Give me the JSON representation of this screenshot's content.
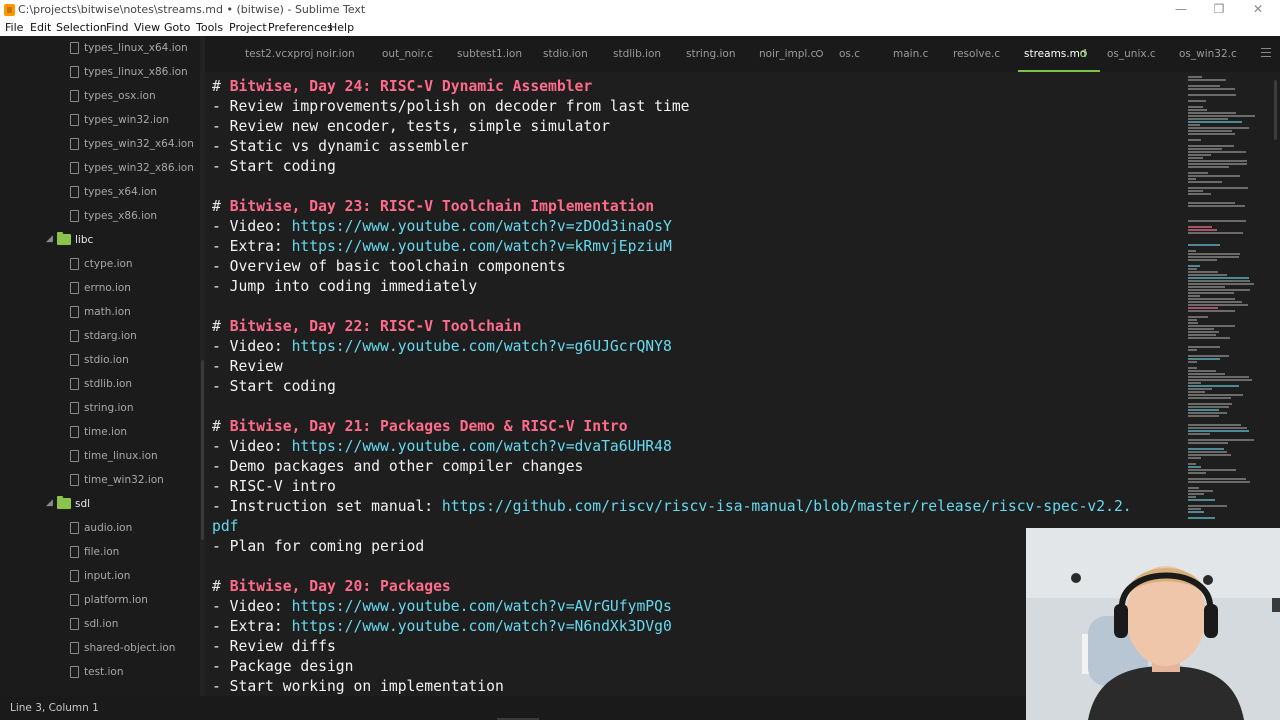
{
  "window": {
    "title": "C:\\projects\\bitwise\\notes\\streams.md • (bitwise) - Sublime Text",
    "minimize_glyph": "—",
    "maximize_glyph": "❐",
    "close_glyph": "✕"
  },
  "menu": [
    "File",
    "Edit",
    "Selection",
    "Find",
    "View",
    "Goto",
    "Tools",
    "Project",
    "Preferences",
    "Help"
  ],
  "sidebar": {
    "items": [
      {
        "type": "file",
        "label": "types_linux_x64.ion"
      },
      {
        "type": "file",
        "label": "types_linux_x86.ion"
      },
      {
        "type": "file",
        "label": "types_osx.ion"
      },
      {
        "type": "file",
        "label": "types_win32.ion"
      },
      {
        "type": "file",
        "label": "types_win32_x64.ion"
      },
      {
        "type": "file",
        "label": "types_win32_x86.ion"
      },
      {
        "type": "file",
        "label": "types_x64.ion"
      },
      {
        "type": "file",
        "label": "types_x86.ion"
      },
      {
        "type": "folder",
        "label": "libc",
        "chevron": "◢"
      },
      {
        "type": "file",
        "label": "ctype.ion"
      },
      {
        "type": "file",
        "label": "errno.ion"
      },
      {
        "type": "file",
        "label": "math.ion"
      },
      {
        "type": "file",
        "label": "stdarg.ion"
      },
      {
        "type": "file",
        "label": "stdio.ion"
      },
      {
        "type": "file",
        "label": "stdlib.ion"
      },
      {
        "type": "file",
        "label": "string.ion"
      },
      {
        "type": "file",
        "label": "time.ion"
      },
      {
        "type": "file",
        "label": "time_linux.ion"
      },
      {
        "type": "file",
        "label": "time_win32.ion"
      },
      {
        "type": "folder",
        "label": "sdl",
        "chevron": "◢"
      },
      {
        "type": "file",
        "label": "audio.ion"
      },
      {
        "type": "file",
        "label": "file.ion"
      },
      {
        "type": "file",
        "label": "input.ion"
      },
      {
        "type": "file",
        "label": "platform.ion"
      },
      {
        "type": "file",
        "label": "sdl.ion"
      },
      {
        "type": "file",
        "label": "shared-object.ion"
      },
      {
        "type": "file",
        "label": "test.ion"
      }
    ]
  },
  "tabs": [
    {
      "label": "test2.vcxproj"
    },
    {
      "label": "noir.ion"
    },
    {
      "label": "out_noir.c"
    },
    {
      "label": "subtest1.ion"
    },
    {
      "label": "stdio.ion"
    },
    {
      "label": "stdlib.ion"
    },
    {
      "label": "string.ion"
    },
    {
      "label": "noir_impl.c",
      "dirty": true
    },
    {
      "label": "os.c"
    },
    {
      "label": "main.c"
    },
    {
      "label": "resolve.c"
    },
    {
      "label": "streams.md",
      "active": true,
      "dirty": true
    },
    {
      "label": "os_unix.c"
    },
    {
      "label": "os_win32.c"
    }
  ],
  "editor": {
    "lines": [
      {
        "parts": [
          {
            "k": "hash",
            "t": "# "
          },
          {
            "k": "head",
            "t": "Bitwise, Day 24: RISC-V Dynamic Assembler"
          }
        ]
      },
      {
        "parts": [
          {
            "k": "text",
            "t": "- Review improvements/polish on decoder from last time"
          }
        ]
      },
      {
        "parts": [
          {
            "k": "text",
            "t": "- Review new encoder, tests, simple simulator"
          }
        ]
      },
      {
        "parts": [
          {
            "k": "text",
            "t": "- Static vs dynamic assembler"
          }
        ]
      },
      {
        "parts": [
          {
            "k": "text",
            "t": "- Start coding"
          }
        ]
      },
      {
        "parts": []
      },
      {
        "parts": [
          {
            "k": "hash",
            "t": "# "
          },
          {
            "k": "head",
            "t": "Bitwise, Day 23: RISC-V Toolchain Implementation"
          }
        ]
      },
      {
        "parts": [
          {
            "k": "text",
            "t": "- Video: "
          },
          {
            "k": "link",
            "t": "https://www.youtube.com/watch?v=zDOd3inaOsY"
          }
        ]
      },
      {
        "parts": [
          {
            "k": "text",
            "t": "- Extra: "
          },
          {
            "k": "link",
            "t": "https://www.youtube.com/watch?v=kRmvjEpziuM"
          }
        ]
      },
      {
        "parts": [
          {
            "k": "text",
            "t": "- Overview of basic toolchain components"
          }
        ]
      },
      {
        "parts": [
          {
            "k": "text",
            "t": "- Jump into coding immediately"
          }
        ]
      },
      {
        "parts": []
      },
      {
        "parts": [
          {
            "k": "hash",
            "t": "# "
          },
          {
            "k": "head",
            "t": "Bitwise, Day 22: RISC-V Toolchain"
          }
        ]
      },
      {
        "parts": [
          {
            "k": "text",
            "t": "- Video: "
          },
          {
            "k": "link",
            "t": "https://www.youtube.com/watch?v=g6UJGcrQNY8"
          }
        ]
      },
      {
        "parts": [
          {
            "k": "text",
            "t": "- Review"
          }
        ]
      },
      {
        "parts": [
          {
            "k": "text",
            "t": "- Start coding"
          }
        ]
      },
      {
        "parts": []
      },
      {
        "parts": [
          {
            "k": "hash",
            "t": "# "
          },
          {
            "k": "head",
            "t": "Bitwise, Day 21: Packages Demo & RISC-V Intro"
          }
        ]
      },
      {
        "parts": [
          {
            "k": "text",
            "t": "- Video: "
          },
          {
            "k": "link",
            "t": "https://www.youtube.com/watch?v=dvaTa6UHR48"
          }
        ]
      },
      {
        "parts": [
          {
            "k": "text",
            "t": "- Demo packages and other compiler changes"
          }
        ]
      },
      {
        "parts": [
          {
            "k": "text",
            "t": "- RISC-V intro"
          }
        ]
      },
      {
        "parts": [
          {
            "k": "text",
            "t": "- Instruction set manual: "
          },
          {
            "k": "link",
            "t": "https://github.com/riscv/riscv-isa-manual/blob/master/release/riscv-spec-v2.2."
          }
        ]
      },
      {
        "parts": [
          {
            "k": "link",
            "t": "pdf"
          }
        ]
      },
      {
        "parts": [
          {
            "k": "text",
            "t": "- Plan for coming period"
          }
        ]
      },
      {
        "parts": []
      },
      {
        "parts": [
          {
            "k": "hash",
            "t": "# "
          },
          {
            "k": "head",
            "t": "Bitwise, Day 20: Packages"
          }
        ]
      },
      {
        "parts": [
          {
            "k": "text",
            "t": "- Video: "
          },
          {
            "k": "link",
            "t": "https://www.youtube.com/watch?v=AVrGUfymPQs"
          }
        ]
      },
      {
        "parts": [
          {
            "k": "text",
            "t": "- Extra: "
          },
          {
            "k": "link",
            "t": "https://www.youtube.com/watch?v=N6ndXk3DVg0"
          }
        ]
      },
      {
        "parts": [
          {
            "k": "text",
            "t": "- Review diffs"
          }
        ]
      },
      {
        "parts": [
          {
            "k": "text",
            "t": "- Package design"
          }
        ]
      },
      {
        "parts": [
          {
            "k": "text",
            "t": "- Start working on implementation"
          }
        ]
      }
    ]
  },
  "status": {
    "position": "Line 3, Column 1"
  },
  "colors": {
    "heading": "#ff6b8b",
    "link": "#66d9ef",
    "text": "#f2f2f2",
    "accent": "#7ec24a",
    "folder": "#8bc34a"
  }
}
